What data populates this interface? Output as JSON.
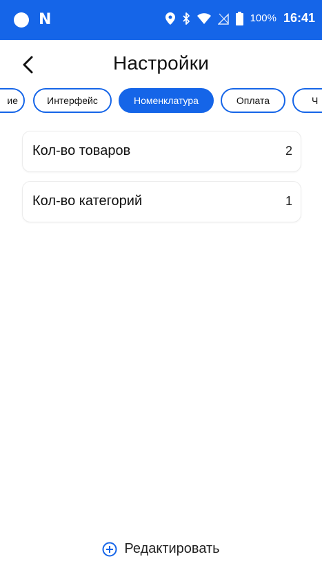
{
  "status_bar": {
    "battery_percent": "100%",
    "time": "16:41",
    "icons": [
      "notification-dot-icon",
      "n-app-icon",
      "location-icon",
      "bluetooth-icon",
      "wifi-icon",
      "no-sim-icon",
      "battery-icon"
    ]
  },
  "header": {
    "title": "Настройки",
    "back_icon": "chevron-left-icon"
  },
  "tabs": [
    {
      "label": "ие",
      "active": false
    },
    {
      "label": "Интерфейс",
      "active": false
    },
    {
      "label": "Номенклатура",
      "active": true
    },
    {
      "label": "Оплата",
      "active": false
    },
    {
      "label": "Ч",
      "active": false
    }
  ],
  "items": [
    {
      "label": "Кол-во товаров",
      "value": "2"
    },
    {
      "label": "Кол-во категорий",
      "value": "1"
    }
  ],
  "edit_button": {
    "label": "Редактировать",
    "icon": "add-circle-icon"
  },
  "colors": {
    "accent": "#1565e8"
  }
}
